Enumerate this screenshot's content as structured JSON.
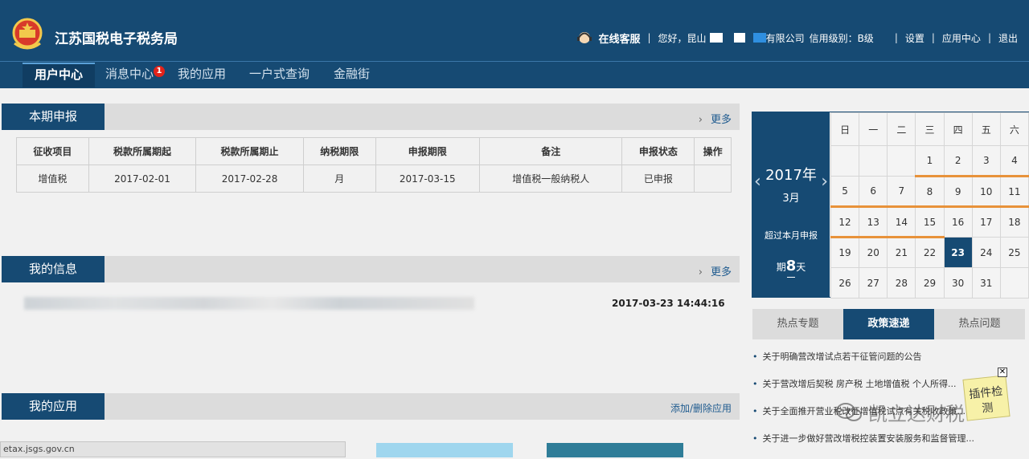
{
  "header": {
    "title": "江苏国税电子税务局",
    "online_service": "在线客服",
    "greeting": "您好，昆山",
    "company_suffix": "有限公司",
    "credit_label": "信用级别：B级",
    "settings": "设置",
    "app_center": "应用中心",
    "logout": "退出",
    "separator": "|"
  },
  "nav": {
    "items": [
      {
        "label": "用户中心"
      },
      {
        "label": "消息中心",
        "badge": "1"
      },
      {
        "label": "我的应用"
      },
      {
        "label": "一户式查询"
      },
      {
        "label": "金融街"
      }
    ]
  },
  "declaration": {
    "title": "本期申报",
    "more": "更多",
    "more_chevron": "›",
    "columns": [
      "征收项目",
      "税款所属期起",
      "税款所属期止",
      "纳税期限",
      "申报期限",
      "备注",
      "申报状态",
      "操作"
    ],
    "rows": [
      [
        "增值税",
        "2017-02-01",
        "2017-02-28",
        "月",
        "2017-03-15",
        "增值税一般纳税人",
        "已申报",
        ""
      ]
    ]
  },
  "my_info": {
    "title": "我的信息",
    "more": "更多",
    "message_time": "2017-03-23 14:44:16"
  },
  "my_apps": {
    "title": "我的应用",
    "add_remove": "添加/删除应用"
  },
  "status_bar": {
    "url": "etax.jsgs.gov.cn"
  },
  "calendar": {
    "year": "2017年",
    "month": "3月",
    "prev_arrow": "‹",
    "next_arrow": "›",
    "note": "超过本月申报",
    "days_prefix": "期",
    "days_value": "8",
    "days_suffix": "天",
    "weekdays": [
      "日",
      "一",
      "二",
      "三",
      "四",
      "五",
      "六"
    ],
    "weeks": [
      [
        "",
        "",
        "",
        "1",
        "2",
        "3",
        "4"
      ],
      [
        "5",
        "6",
        "7",
        "8",
        "9",
        "10",
        "11"
      ],
      [
        "12",
        "13",
        "14",
        "15",
        "16",
        "17",
        "18"
      ],
      [
        "19",
        "20",
        "21",
        "22",
        "23",
        "24",
        "25"
      ],
      [
        "26",
        "27",
        "28",
        "29",
        "30",
        "31",
        ""
      ]
    ],
    "today": "23",
    "colors": {
      "accent": "#164a73",
      "deadline_underline": "#e8923a"
    }
  },
  "policy": {
    "tabs": [
      "热点专题",
      "政策速递",
      "热点问题"
    ],
    "active_tab": 1,
    "items": [
      "关于明确营改增试点若干征管问题的公告",
      "关于营改增后契税 房产税 土地增值税 个人所得...",
      "关于全面推开营业税改征增值税试点有关税收政策...",
      "关于进一步做好营改增税控装置安装服务和监督管理..."
    ]
  },
  "plugin": {
    "label": "插件检测",
    "close": "✕"
  },
  "watermark": {
    "text": "凯立达财税"
  },
  "theme": {
    "primary": "#164a73",
    "background": "#f1f1f1",
    "badge": "#e2231a"
  }
}
